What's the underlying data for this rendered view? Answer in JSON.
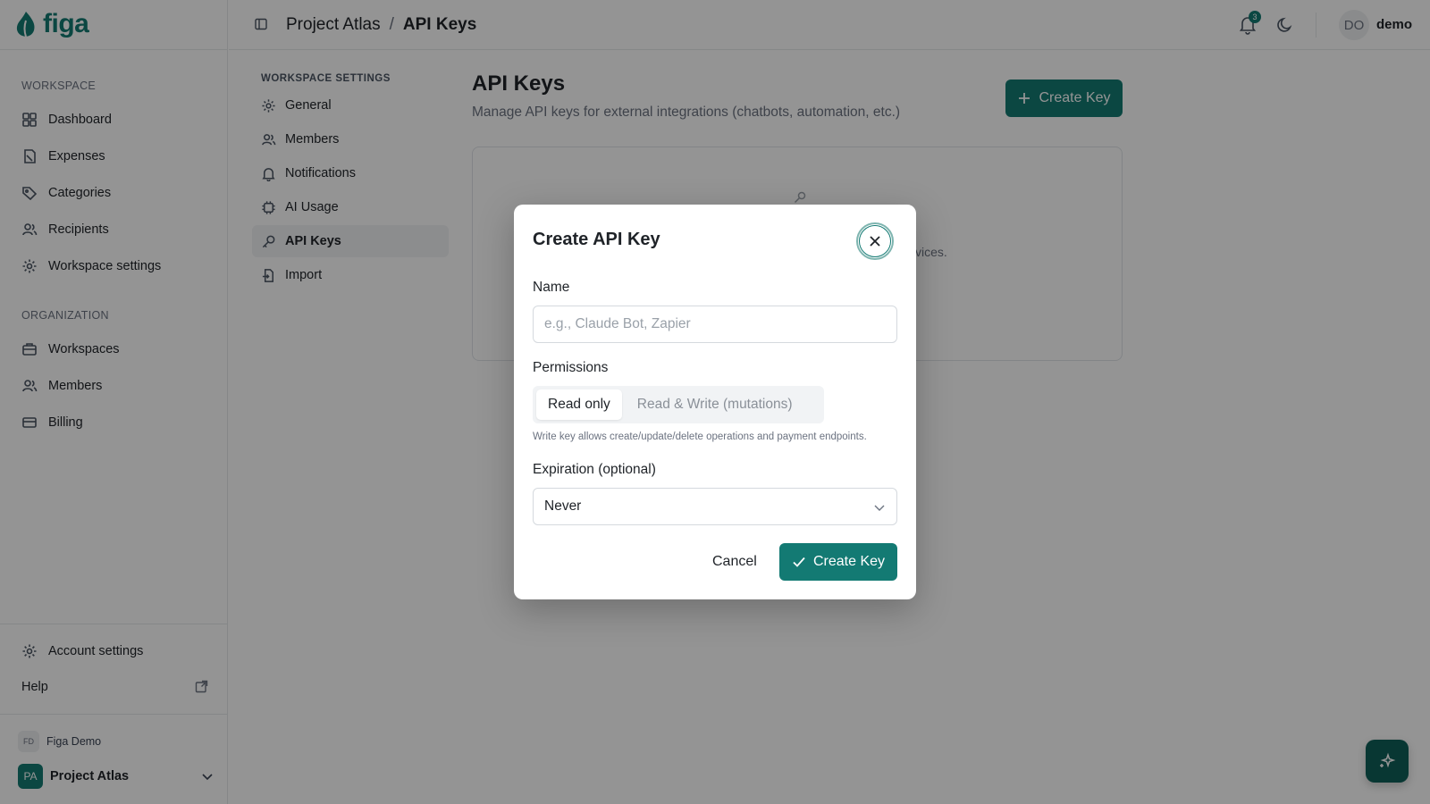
{
  "app": {
    "logo_text": "figa",
    "brand_color": "#137a73"
  },
  "sidebar": {
    "workspace_label": "WORKSPACE",
    "workspace_items": [
      {
        "label": "Dashboard",
        "icon": "dashboard-icon"
      },
      {
        "label": "Expenses",
        "icon": "receipt-icon"
      },
      {
        "label": "Categories",
        "icon": "tag-icon"
      },
      {
        "label": "Recipients",
        "icon": "users-icon"
      },
      {
        "label": "Workspace settings",
        "icon": "gear-icon"
      }
    ],
    "organization_label": "ORGANIZATION",
    "organization_items": [
      {
        "label": "Workspaces",
        "icon": "briefcase-icon"
      },
      {
        "label": "Members",
        "icon": "users-icon"
      },
      {
        "label": "Billing",
        "icon": "credit-card-icon"
      }
    ],
    "account_settings": "Account settings",
    "help": "Help",
    "org": {
      "initials": "FD",
      "name": "Figa Demo"
    },
    "workspace": {
      "initials": "PA",
      "name": "Project Atlas"
    }
  },
  "header": {
    "breadcrumb": {
      "parent": "Project Atlas",
      "separator": "/",
      "current": "API Keys"
    },
    "notifications_count": "3",
    "user": {
      "initials": "DO",
      "name": "demo"
    }
  },
  "settings_nav": {
    "label": "WORKSPACE SETTINGS",
    "items": [
      {
        "label": "General",
        "icon": "gear-icon"
      },
      {
        "label": "Members",
        "icon": "users-icon"
      },
      {
        "label": "Notifications",
        "icon": "bell-icon"
      },
      {
        "label": "AI Usage",
        "icon": "chip-icon"
      },
      {
        "label": "API Keys",
        "icon": "key-icon",
        "active": true
      },
      {
        "label": "Import",
        "icon": "import-icon"
      }
    ]
  },
  "main": {
    "title": "API Keys",
    "subtitle": "Manage API keys for external integrations (chatbots, automation, etc.)",
    "create_button": "Create Key",
    "empty_fragment": "vices."
  },
  "modal": {
    "title": "Create API Key",
    "name_label": "Name",
    "name_placeholder": "e.g., Claude Bot, Zapier",
    "name_value": "",
    "permissions_label": "Permissions",
    "permission_options": [
      "Read only",
      "Read & Write (mutations)"
    ],
    "permission_selected": "Read only",
    "permissions_help": "Write key allows create/update/delete operations and payment endpoints.",
    "expiration_label": "Expiration (optional)",
    "expiration_value": "Never",
    "cancel_label": "Cancel",
    "submit_label": "Create Key"
  }
}
